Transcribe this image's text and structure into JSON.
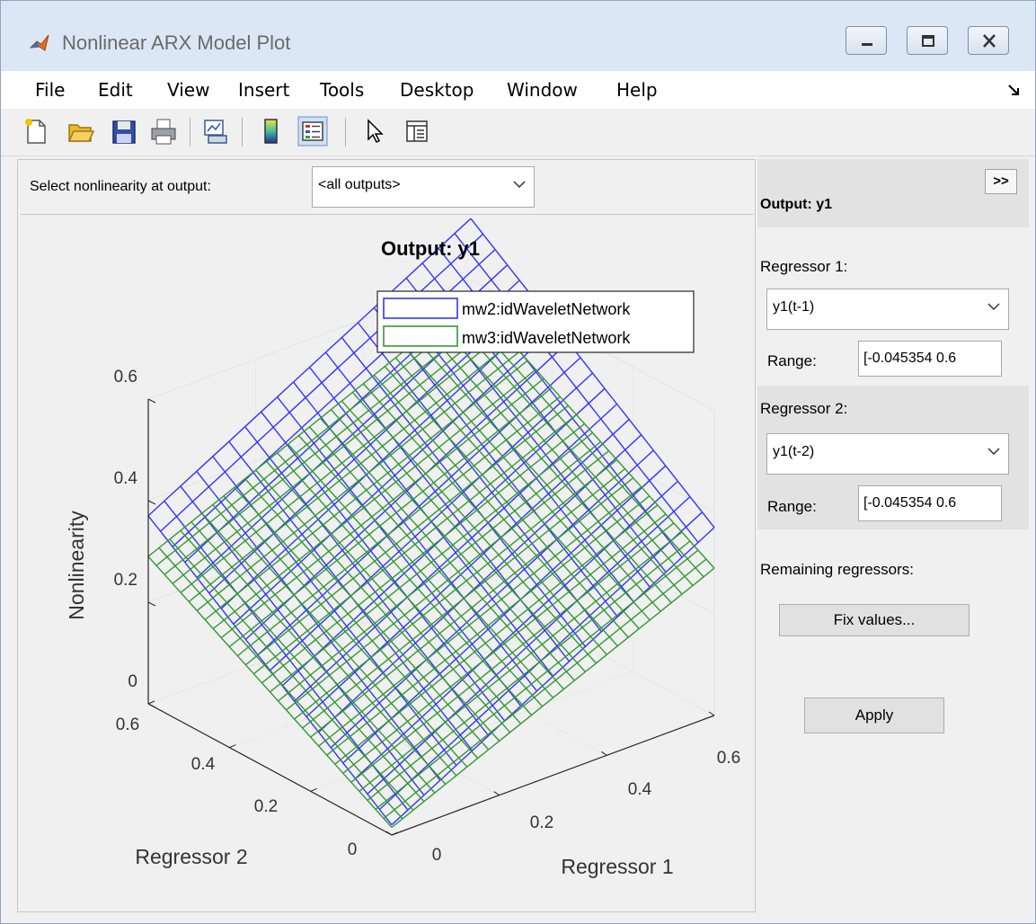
{
  "window": {
    "title": "Nonlinear ARX Model Plot"
  },
  "menu": [
    "File",
    "Edit",
    "View",
    "Insert",
    "Tools",
    "Desktop",
    "Window",
    "Help"
  ],
  "toolbar_icons": [
    "new-figure-icon",
    "open-file-icon",
    "save-icon",
    "print-icon",
    "link-plot-icon",
    "colorbar-icon",
    "legend-icon",
    "pointer-icon",
    "property-editor-icon"
  ],
  "selector": {
    "label": "Select nonlinearity at output:",
    "value": "<all outputs>"
  },
  "side_panel": {
    "expand_label": ">>",
    "title": "Output: y1",
    "regressor1": {
      "label": "Regressor 1:",
      "value": "y1(t-1)",
      "range_label": "Range:",
      "range_value": "[-0.045354   0.6"
    },
    "regressor2": {
      "label": "Regressor 2:",
      "value": "y1(t-2)",
      "range_label": "Range:",
      "range_value": "[-0.045354   0.6"
    },
    "remaining_label": "Remaining regressors:",
    "fix_button": "Fix values...",
    "apply_button": "Apply"
  },
  "chart_data": {
    "type": "surface",
    "title": "Output: y1",
    "zlabel": "Nonlinearity",
    "xlabel": "Regressor 1",
    "ylabel": "Regressor 2",
    "z_ticks": [
      "0",
      "0.2",
      "0.4",
      "0.6"
    ],
    "x_ticks": [
      "0",
      "0.2",
      "0.4",
      "0.6"
    ],
    "y_ticks": [
      "0",
      "0.2",
      "0.4",
      "0.6"
    ],
    "legend_position": "top-right",
    "series": [
      {
        "name": "mw2:idWaveletNetwork",
        "color": "#3333ff"
      },
      {
        "name": "mw3:idWaveletNetwork",
        "color": "#339933"
      }
    ]
  }
}
